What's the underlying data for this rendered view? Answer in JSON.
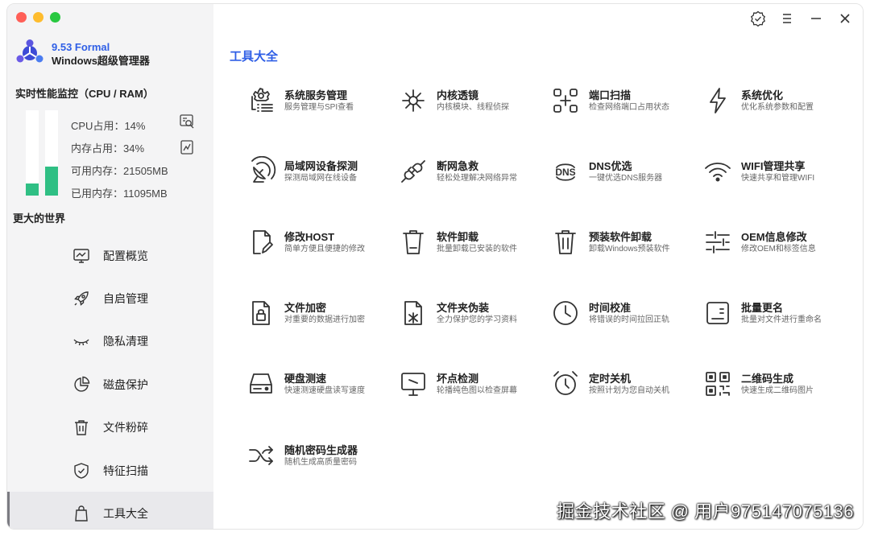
{
  "colors": {
    "accent": "#2f5fe6",
    "bar_fill": "#2fbf84",
    "sidebar_bg": "#f4f4f5",
    "close_light": "#ff5f57",
    "min_light": "#febc2e",
    "max_light": "#28c840"
  },
  "app": {
    "version": "9.53 Formal",
    "name": "Windows超级管理器"
  },
  "monitor": {
    "title": "实时性能监控（CPU / RAM）",
    "cpu_percent": 14,
    "ram_percent": 34,
    "stats": {
      "cpu": "CPU占用：14%",
      "ram": "内存占用：34%",
      "available": "可用内存：21505MB",
      "used": "已用内存：11095MB"
    },
    "cpu_icon": "cpu-detail-icon",
    "ram_icon": "ram-detail-icon"
  },
  "sidebar": {
    "section_title": "更大的世界",
    "items": [
      {
        "label": "配置概览",
        "icon": "monitor-icon"
      },
      {
        "label": "自启管理",
        "icon": "rocket-icon"
      },
      {
        "label": "隐私清理",
        "icon": "eye-closed-icon"
      },
      {
        "label": "磁盘保护",
        "icon": "pie-chart-icon"
      },
      {
        "label": "文件粉碎",
        "icon": "trash-icon"
      },
      {
        "label": "特征扫描",
        "icon": "shield-check-icon"
      },
      {
        "label": "工具大全",
        "icon": "bag-icon"
      }
    ],
    "active_index": 6
  },
  "titlebar": {
    "icons": [
      "badge-check-icon",
      "menu-icon",
      "minimize-icon",
      "close-icon"
    ]
  },
  "main": {
    "title": "工具大全",
    "tools": [
      {
        "title": "系统服务管理",
        "desc": "服务管理与SPI查看",
        "icon": "gear-list-icon"
      },
      {
        "title": "内核透镜",
        "desc": "内核模块、线程侦探",
        "icon": "bug-icon"
      },
      {
        "title": "端口扫描",
        "desc": "检查网络端口占用状态",
        "icon": "scan-icon"
      },
      {
        "title": "系统优化",
        "desc": "优化系统参数和配置",
        "icon": "lightning-icon"
      },
      {
        "title": "局域网设备探测",
        "desc": "探测局域网在线设备",
        "icon": "satellite-icon"
      },
      {
        "title": "断网急救",
        "desc": "轻松处理解决网络异常",
        "icon": "plug-icon"
      },
      {
        "title": "DNS优选",
        "desc": "一键优选DNS服务器",
        "icon": "dns-icon"
      },
      {
        "title": "WIFI管理共享",
        "desc": "快速共享和管理WIFI",
        "icon": "wifi-icon"
      },
      {
        "title": "修改HOST",
        "desc": "简单方便且便捷的修改",
        "icon": "file-edit-icon"
      },
      {
        "title": "软件卸载",
        "desc": "批量卸载已安装的软件",
        "icon": "bin-icon"
      },
      {
        "title": "预装软件卸载",
        "desc": "卸载Windows预装软件",
        "icon": "bin-lines-icon"
      },
      {
        "title": "OEM信息修改",
        "desc": "修改OEM和标签信息",
        "icon": "sliders-icon"
      },
      {
        "title": "文件加密",
        "desc": "对重要的数据进行加密",
        "icon": "file-lock-icon"
      },
      {
        "title": "文件夹伪装",
        "desc": "全力保护您的学习资料",
        "icon": "file-mask-icon"
      },
      {
        "title": "时间校准",
        "desc": "将错误的时间拉回正轨",
        "icon": "clock-icon"
      },
      {
        "title": "批量更名",
        "desc": "批量对文件进行重命名",
        "icon": "rename-icon"
      },
      {
        "title": "硬盘测速",
        "desc": "快速测速硬盘读写速度",
        "icon": "harddisk-icon"
      },
      {
        "title": "坏点检测",
        "desc": "轮播纯色图以检查屏幕",
        "icon": "display-icon"
      },
      {
        "title": "定时关机",
        "desc": "按照计划为您自动关机",
        "icon": "alarm-clock-icon"
      },
      {
        "title": "二维码生成",
        "desc": "快速生成二维码图片",
        "icon": "qrcode-icon"
      },
      {
        "title": "随机密码生成器",
        "desc": "随机生成高质量密码",
        "icon": "shuffle-icon"
      }
    ]
  },
  "watermark": "掘金技术社区 @ 用户975147075136"
}
